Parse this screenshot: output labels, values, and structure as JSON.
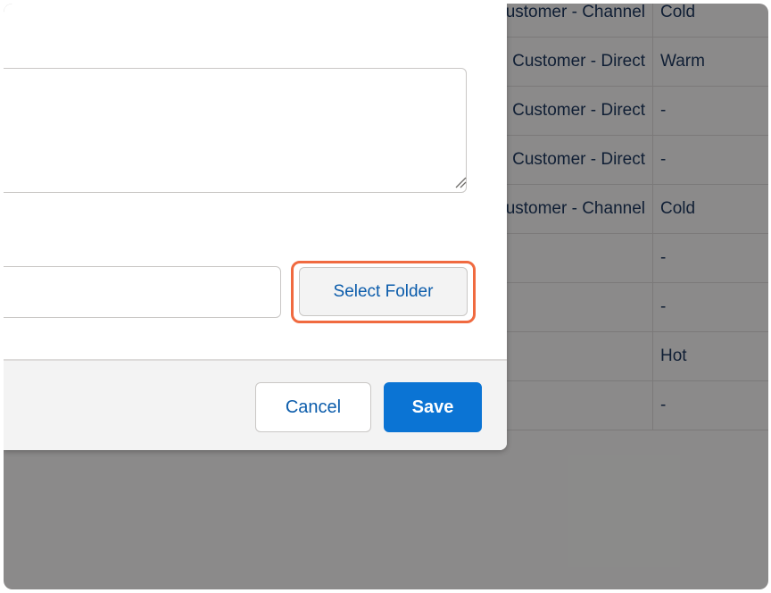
{
  "background_table": {
    "rows": [
      {
        "type": "Customer - Channel",
        "rating": "Cold"
      },
      {
        "type": "Customer - Direct",
        "rating": "Warm"
      },
      {
        "type": "Customer - Direct",
        "rating": "-"
      },
      {
        "type": "Customer - Direct",
        "rating": "-"
      },
      {
        "type": "Customer - Channel",
        "rating": "Cold"
      },
      {
        "type": "",
        "rating": "-"
      },
      {
        "type": "",
        "rating": "-"
      },
      {
        "type": "",
        "rating": "Hot"
      },
      {
        "type": "",
        "rating": "-"
      }
    ]
  },
  "modal": {
    "description_value": "",
    "folder_value": "",
    "select_folder_label": "Select Folder",
    "footer": {
      "cancel_label": "Cancel",
      "save_label": "Save"
    }
  },
  "colors": {
    "brand_blue": "#0b74d4",
    "link_blue": "#0b5cab",
    "highlight_orange": "#f06a40"
  }
}
